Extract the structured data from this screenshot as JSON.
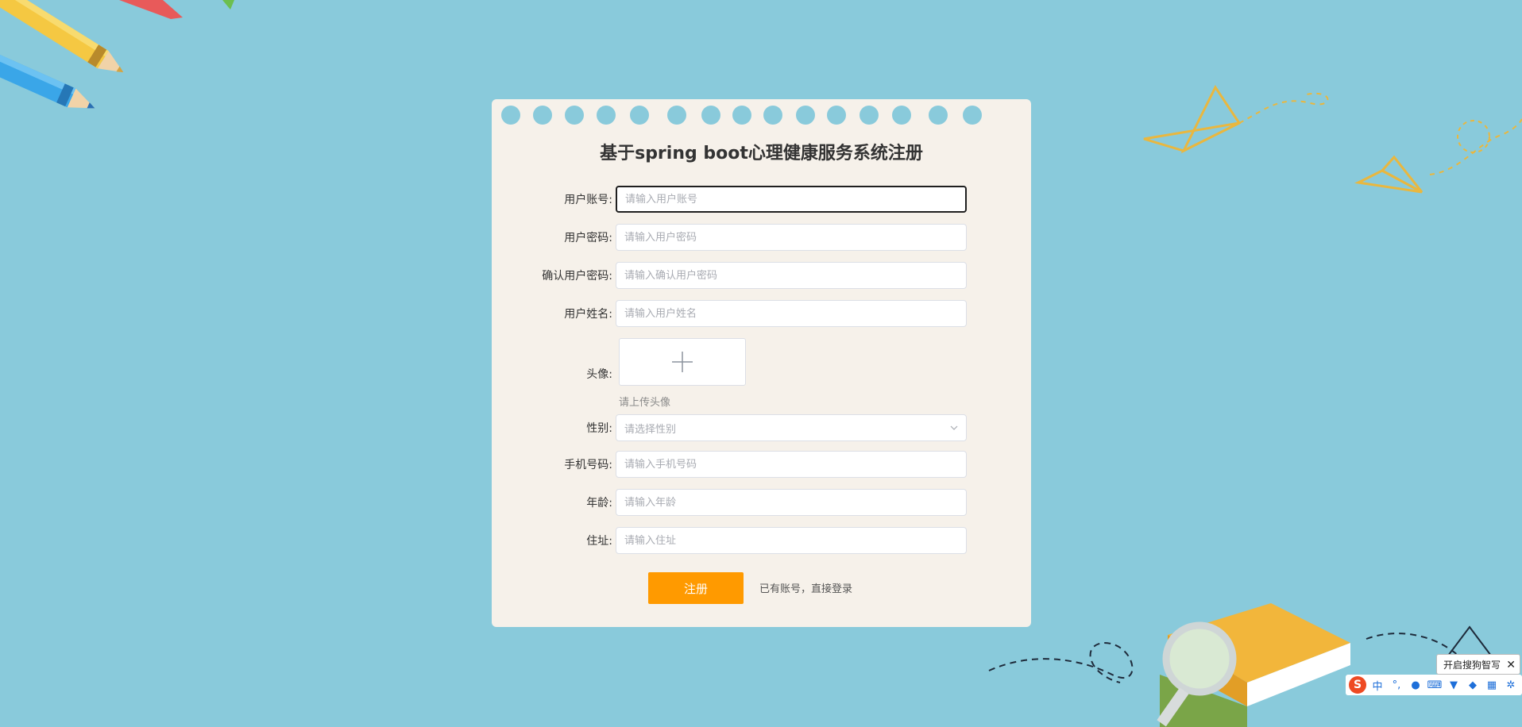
{
  "form": {
    "title": "基于spring boot心理健康服务系统注册",
    "fields": {
      "account": {
        "label": "用户账号:",
        "placeholder": "请输入用户账号"
      },
      "password": {
        "label": "用户密码:",
        "placeholder": "请输入用户密码"
      },
      "confirm_password": {
        "label": "确认用户密码:",
        "placeholder": "请输入确认用户密码"
      },
      "name": {
        "label": "用户姓名:",
        "placeholder": "请输入用户姓名"
      },
      "avatar": {
        "label": "头像:",
        "hint": "请上传头像"
      },
      "gender": {
        "label": "性别:",
        "placeholder": "请选择性别"
      },
      "phone": {
        "label": "手机号码:",
        "placeholder": "请输入手机号码"
      },
      "age": {
        "label": "年龄:",
        "placeholder": "请输入年龄"
      },
      "address": {
        "label": "住址:",
        "placeholder": "请输入住址"
      }
    },
    "submit_label": "注册",
    "login_link": "已有账号，直接登录"
  },
  "ime": {
    "tip": "开启搜狗智写",
    "logo": "S",
    "mode": "中",
    "icons": [
      "punctuation-icon",
      "microphone-icon",
      "keyboard-icon",
      "skin-icon",
      "game-icon",
      "apps-icon",
      "settings-icon"
    ]
  },
  "colors": {
    "background": "#89cadb",
    "card": "#f6f1ea",
    "accent": "#ff9a00"
  }
}
